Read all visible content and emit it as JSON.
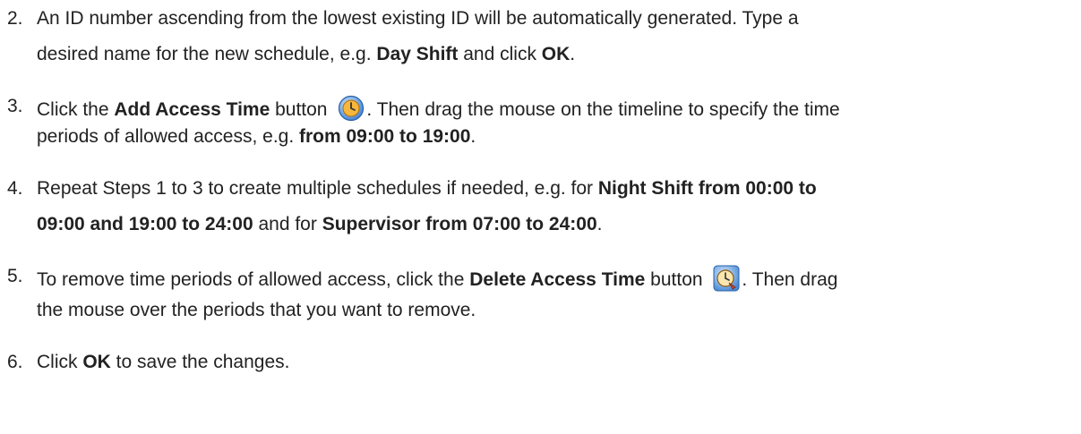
{
  "steps": [
    {
      "num": "2.",
      "l1a": "An ID number ascending from the lowest existing ID will be automatically generated. Type a",
      "l2a": "desired name for the new schedule, e.g. ",
      "l2b": "Day Shift",
      "l2c": " and click ",
      "l2d": "OK",
      "l2e": "."
    },
    {
      "num": "3.",
      "l1a": "Click the ",
      "l1b": "Add Access Time",
      "l1c": " button ",
      "icon": "add-access-time-icon",
      "l1d": ". Then drag the mouse on the timeline to specify the time",
      "l2a": "periods of allowed access, e.g. ",
      "l2b": "from 09:00 to 19:00",
      "l2c": "."
    },
    {
      "num": "4.",
      "l1a": "Repeat Steps 1 to 3 to create multiple schedules if needed, e.g. for ",
      "l1b": "Night Shift from 00:00 to",
      "l2a": "09:00 and 19:00 to 24:00",
      "l2b": " and for ",
      "l2c": "Supervisor from 07:00 to 24:00",
      "l2d": "."
    },
    {
      "num": "5.",
      "l1a": "To remove time periods of allowed access, click the ",
      "l1b": "Delete Access Time",
      "l1c": " button ",
      "icon": "delete-access-time-icon",
      "l1d": ". Then drag",
      "l2a": "the mouse over the periods that you want to remove."
    },
    {
      "num": "6.",
      "l1a": "Click ",
      "l1b": "OK",
      "l1c": " to save the changes."
    }
  ]
}
